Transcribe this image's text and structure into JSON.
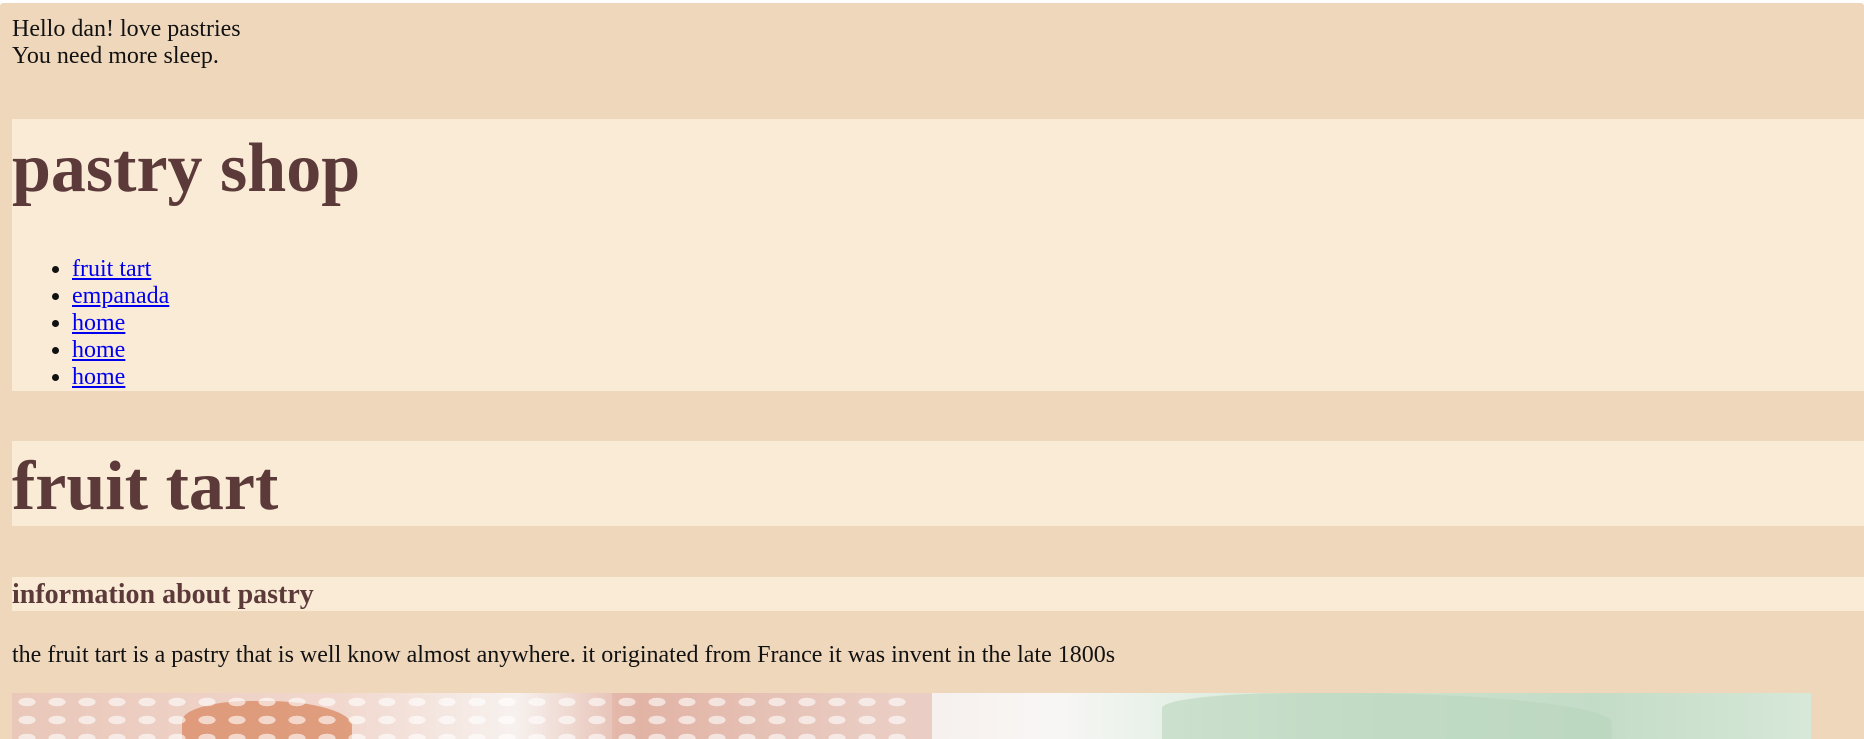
{
  "greeting": {
    "line1": "Hello dan! love pastries",
    "line2": "You need more sleep."
  },
  "header": {
    "title": "pastry shop",
    "nav": [
      {
        "label": "fruit tart"
      },
      {
        "label": "empanada"
      },
      {
        "label": "home"
      },
      {
        "label": "home"
      },
      {
        "label": "home"
      }
    ]
  },
  "main": {
    "title": "fruit tart",
    "section_heading": "information about pastry",
    "description": "the fruit tart is a pastry that is well know almost anywhere. it originated from France it was invent in the late 1800s"
  },
  "colors": {
    "page_background": "#efd7bc",
    "band_background": "#faebd7",
    "heading_color": "#5c3a3a",
    "link_color": "#0000ee"
  }
}
